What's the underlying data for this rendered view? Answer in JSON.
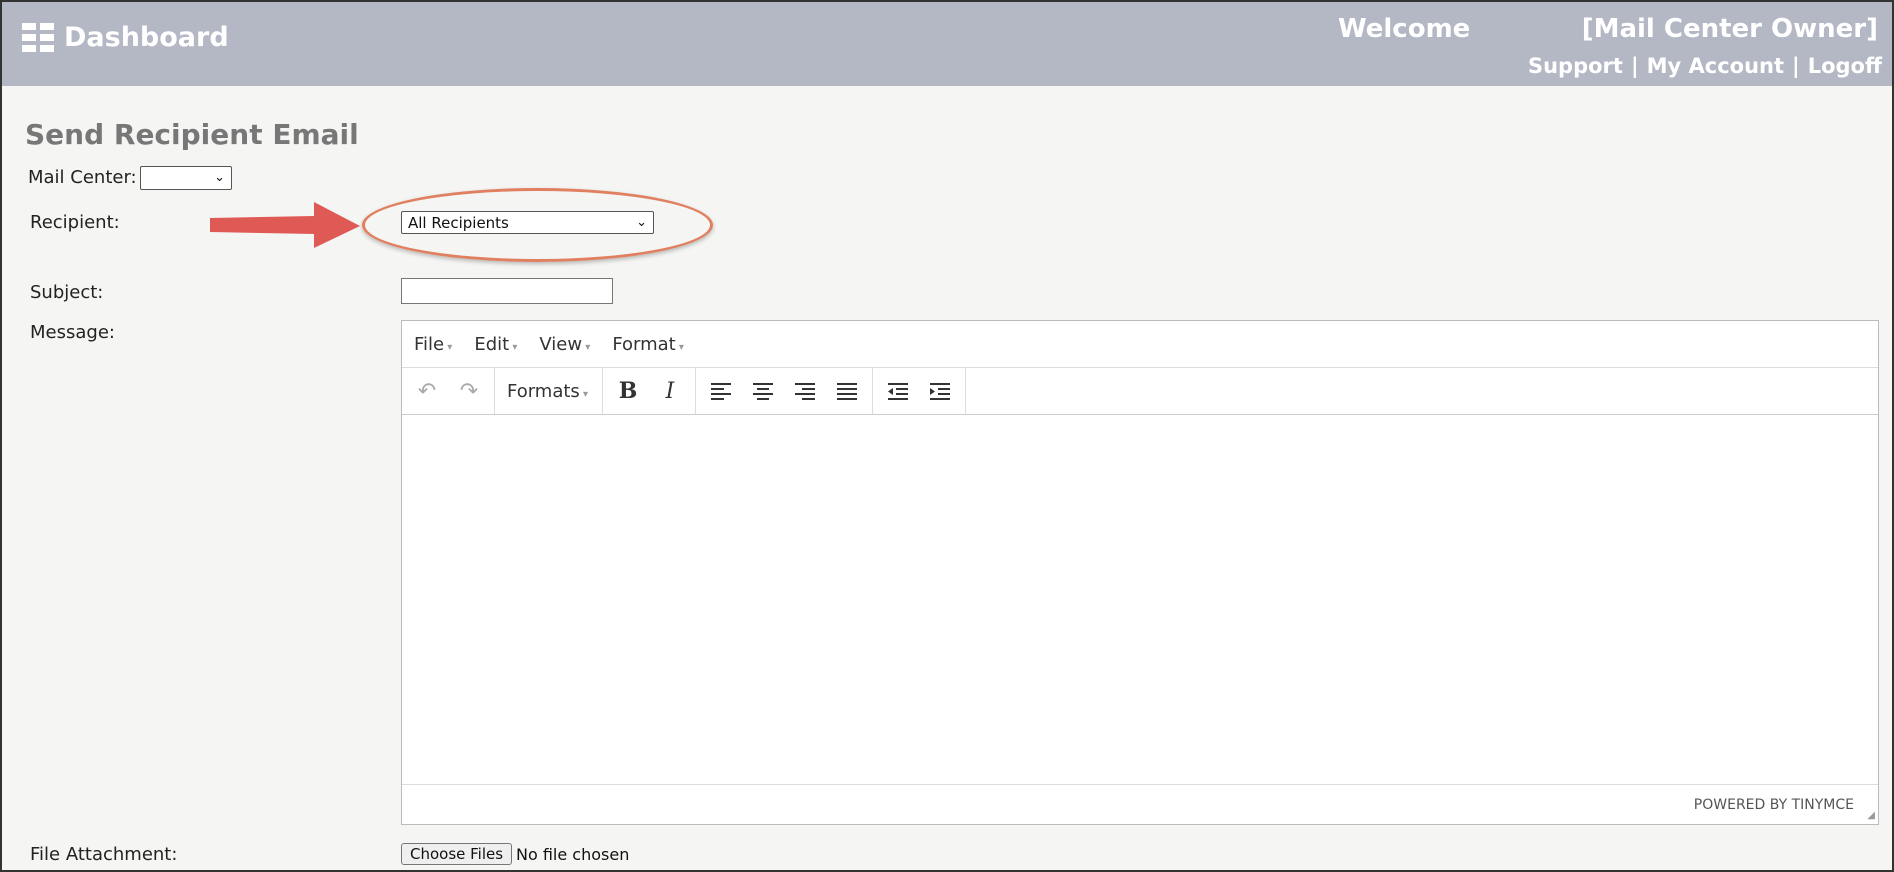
{
  "header": {
    "brand": "Dashboard",
    "welcome": "Welcome",
    "user": "[Mail Center Owner]",
    "links": [
      "Support",
      "My Account",
      "Logoff"
    ],
    "separator": "|",
    "bg_color": "#b3b8c4"
  },
  "page": {
    "title": "Send Recipient Email"
  },
  "form": {
    "mail_center_label": "Mail Center:",
    "mail_center_value": "",
    "recipient_label": "Recipient:",
    "recipient_value": "All Recipients",
    "subject_label": "Subject:",
    "subject_value": "",
    "message_label": "Message:",
    "file_label": "File Attachment:",
    "file_button": "Choose Files",
    "file_status": "No file chosen"
  },
  "editor": {
    "menus": [
      "File",
      "Edit",
      "View",
      "Format"
    ],
    "formats_label": "Formats",
    "powered_by": "POWERED BY TINYMCE",
    "toolbar_icons": [
      "undo-icon",
      "redo-icon",
      "bold-icon",
      "italic-icon",
      "align-left-icon",
      "align-center-icon",
      "align-right-icon",
      "align-justify-icon",
      "outdent-icon",
      "indent-icon"
    ]
  },
  "annotation": {
    "highlight_color": "#e08060",
    "arrow_color": "#e05a55"
  }
}
